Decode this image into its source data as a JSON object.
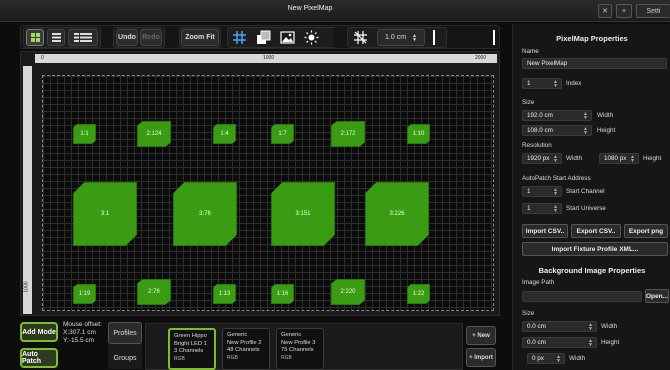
{
  "window": {
    "title": "New PixelMap",
    "settings_label": "Setti"
  },
  "toolbar": {
    "undo": "Undo",
    "redo": "Redo",
    "zoom_fit": "Zoom Fit",
    "grid_size": "1.0 cm"
  },
  "ruler": {
    "h_ticks": [
      "0",
      "1000",
      "2000"
    ],
    "v_ticks": [
      "1000"
    ]
  },
  "fixtures": [
    {
      "label": "1:1"
    },
    {
      "label": "2:124"
    },
    {
      "label": "1:4"
    },
    {
      "label": "1:7"
    },
    {
      "label": "2:172"
    },
    {
      "label": "1:10"
    },
    {
      "label": "3:1"
    },
    {
      "label": "3:76"
    },
    {
      "label": "3:151"
    },
    {
      "label": "3:226"
    },
    {
      "label": "1:19"
    },
    {
      "label": "2:76"
    },
    {
      "label": "1:13"
    },
    {
      "label": "1:16"
    },
    {
      "label": "2:220"
    },
    {
      "label": "1:22"
    }
  ],
  "bottom": {
    "add_mode": "Add Mode",
    "auto_patch": "Auto Patch",
    "mouse_offset_label": "Mouse offset:",
    "mouse_x": "X:307.1 cm",
    "mouse_y": "Y:-15.5 cm",
    "tabs": [
      "Profiles",
      "Groups"
    ],
    "profiles": [
      {
        "maker": "Green Hippo",
        "name": "Bright LED 1",
        "channels": "3 Channels",
        "extra": "RGB"
      },
      {
        "maker": "Generic",
        "name": "New Profile 2",
        "channels": "48 Channels",
        "extra": "RGB"
      },
      {
        "maker": "Generic",
        "name": "New Profile 3",
        "channels": "75 Channels",
        "extra": "RGB"
      }
    ],
    "new_label": "+ New",
    "import_label": "+ Import"
  },
  "props": {
    "header": "PixelMap Properties",
    "name_label": "Name",
    "name_value": "New PixelMap",
    "index_value": "1",
    "index_label": "Index",
    "size_label": "Size",
    "width_value": "192.0 cm",
    "width_label": "Width",
    "height_value": "108.0 cm",
    "height_label": "Height",
    "resolution_label": "Resolution",
    "res_w_value": "1920 px",
    "res_w_label": "Width",
    "res_h_value": "1080 px",
    "res_h_label": "Height",
    "autopatch_label": "AutoPatch Start Address",
    "start_channel_value": "1",
    "start_channel_label": "Start Channel",
    "start_universe_value": "1",
    "start_universe_label": "Start Universe",
    "import_csv": "Import CSV..",
    "export_csv": "Export CSV..",
    "export_png": "Export png",
    "import_fixture": "Import Fixture Profile XML...",
    "bg_header": "Background Image Properties",
    "image_path_label": "Image Path",
    "open_label": "Open...",
    "bg_size_label": "Size",
    "bg_w_value": "0.0 cm",
    "bg_w_label": "Width",
    "bg_h_value": "0.0 cm",
    "bg_h_label": "Height",
    "bg_px_value": "0 px",
    "bg_px_label": "Width"
  }
}
